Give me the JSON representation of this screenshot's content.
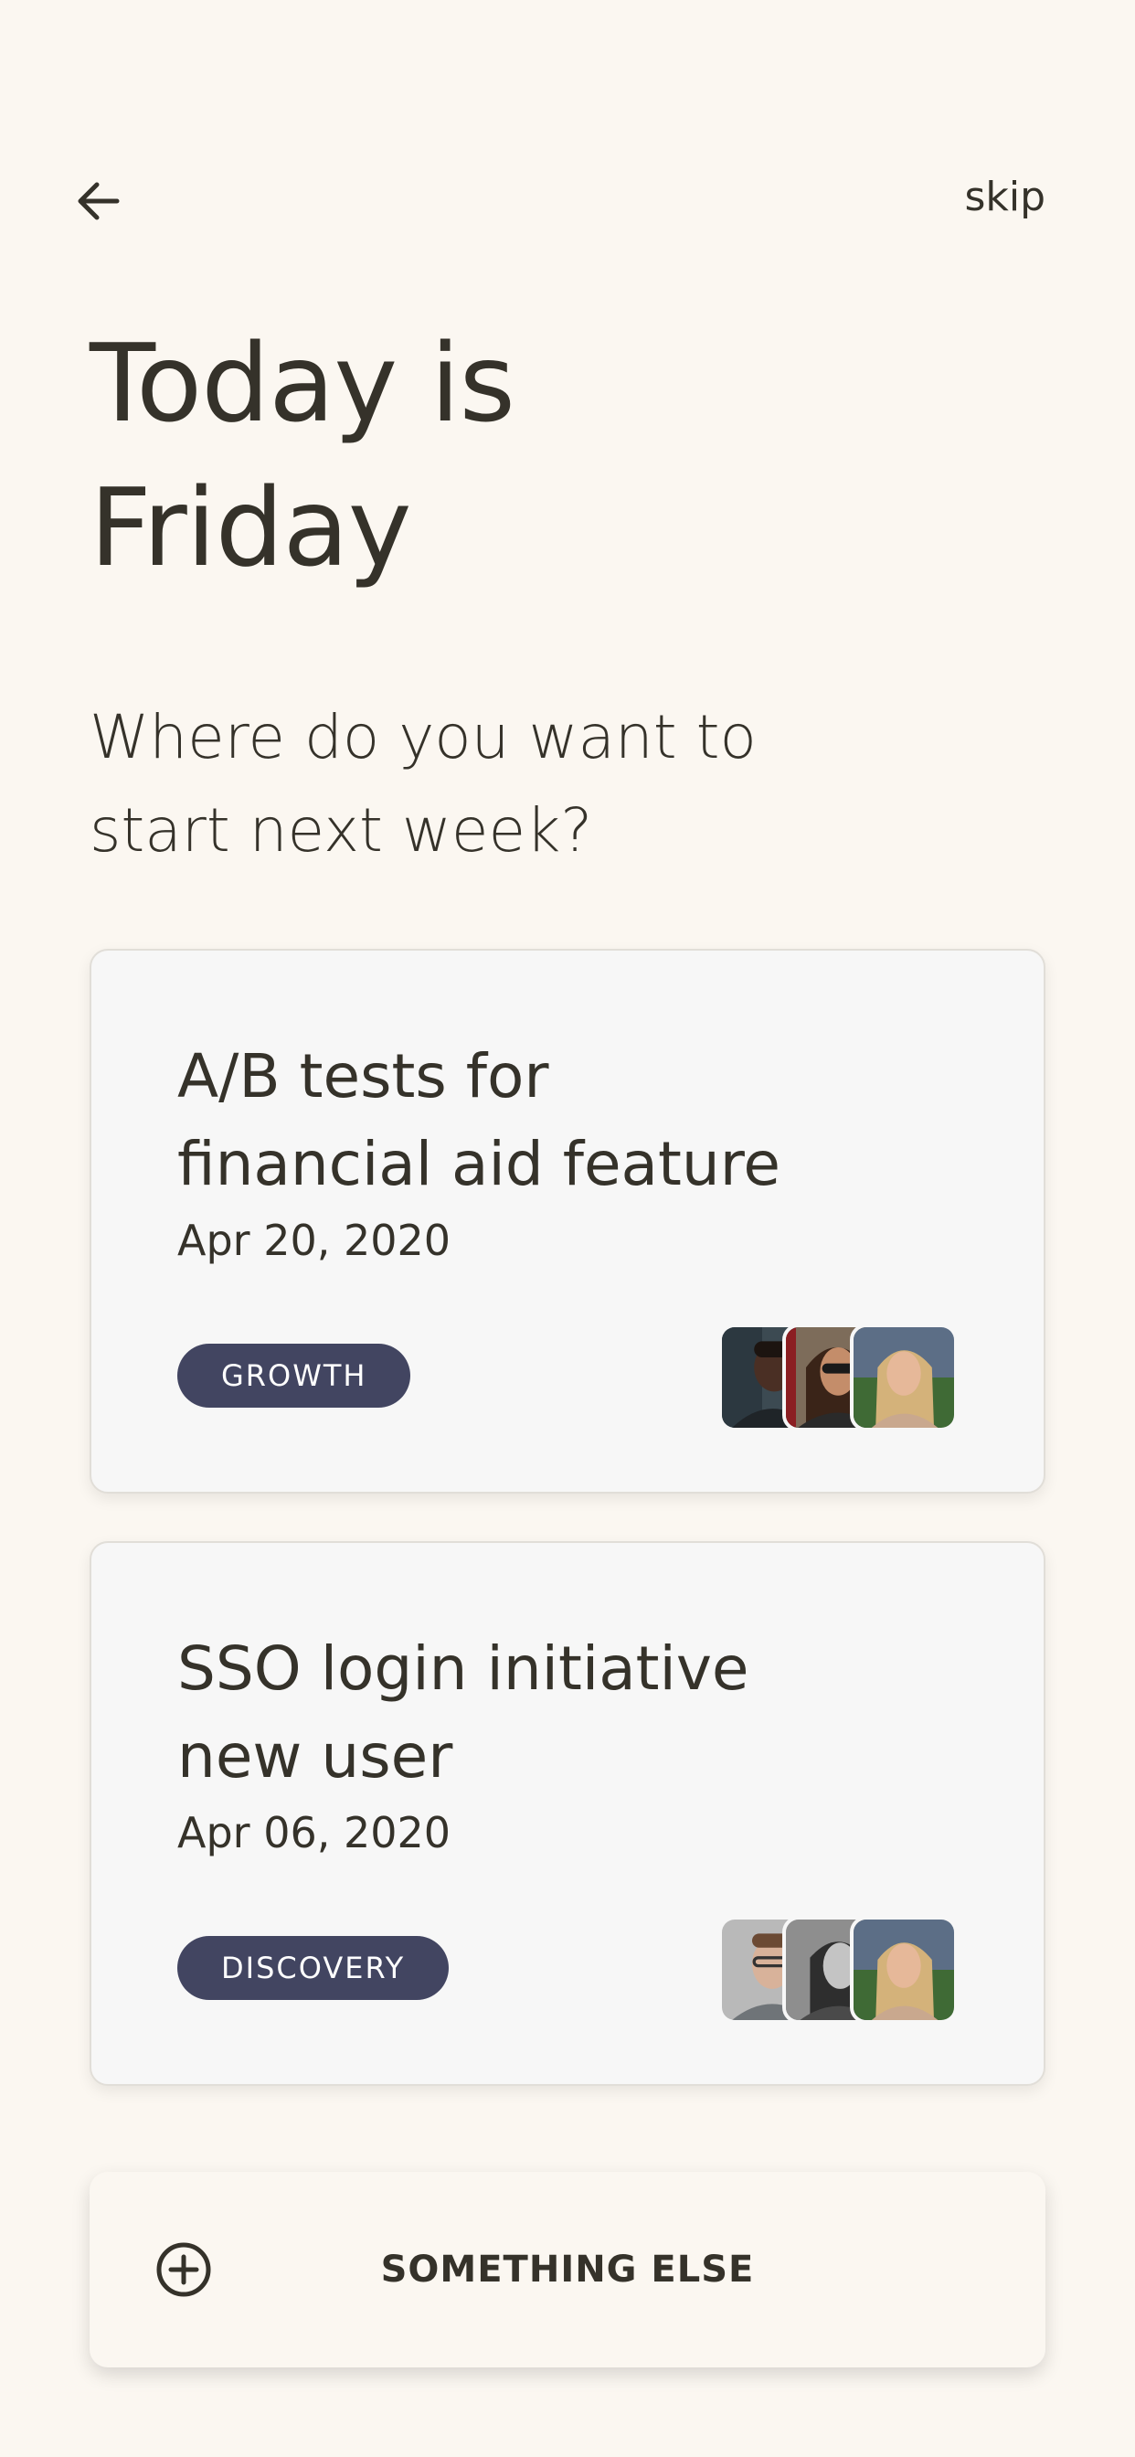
{
  "header": {
    "back_icon": "arrow-left-icon",
    "skip_label": "skip"
  },
  "title": {
    "line1": "Today is",
    "line2": "Friday"
  },
  "subtitle": {
    "line1": "Where do you want to",
    "line2": "start next week?"
  },
  "projects": [
    {
      "title_line1": "A/B tests for",
      "title_line2": "financial aid feature",
      "date": "Apr 20, 2020",
      "tag": "GROWTH",
      "avatars": [
        "avatar-photo",
        "avatar-photo",
        "avatar-photo"
      ]
    },
    {
      "title_line1": "SSO login initiative",
      "title_line2": "new user",
      "date": "Apr 06, 2020",
      "tag": "DISCOVERY",
      "avatars": [
        "avatar-photo",
        "avatar-photo",
        "avatar-photo"
      ]
    }
  ],
  "add_option": {
    "icon": "plus-circle-icon",
    "label": "SOMETHING ELSE"
  },
  "colors": {
    "background": "#fbf7f1",
    "text": "#35322a",
    "tag": "#424561",
    "card": "#f7f7f7"
  }
}
